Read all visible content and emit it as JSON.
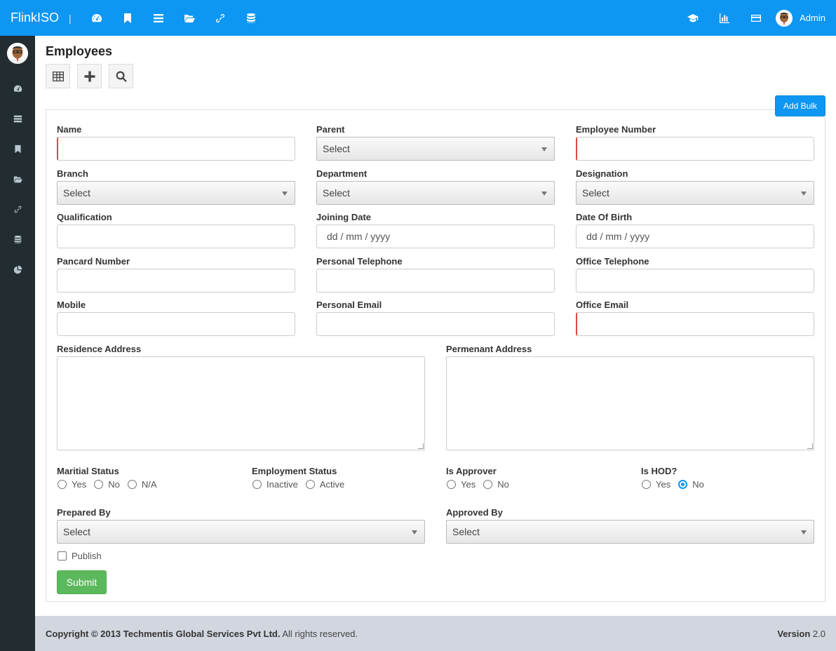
{
  "app": {
    "brand": "FlinkISO",
    "separator": "|",
    "user": "Admin"
  },
  "top_nav": {
    "icons": [
      "dashboard-icon",
      "bookmark-icon",
      "list-icon",
      "folder-open-icon",
      "link-icon",
      "database-icon"
    ]
  },
  "top_right": {
    "icons": [
      "graduation-cap-icon",
      "bar-chart-icon",
      "credit-card-icon"
    ]
  },
  "sidebar": {
    "icons": [
      "dashboard-icon",
      "server-icon",
      "bookmark-icon",
      "folder-open-icon",
      "link-icon",
      "database-icon",
      "pie-chart-icon"
    ]
  },
  "page": {
    "title": "Employees",
    "add_bulk": "Add Bulk",
    "toolbar": [
      "table-icon",
      "plus-icon",
      "search-icon"
    ]
  },
  "form": {
    "name": "Name",
    "parent": "Parent",
    "employee_number": "Employee Number",
    "branch": "Branch",
    "department": "Department",
    "designation": "Designation",
    "qualification": "Qualification",
    "joining_date": "Joining Date",
    "date_of_birth": "Date Of Birth",
    "pancard_number": "Pancard Number",
    "personal_telephone": "Personal Telephone",
    "office_telephone": "Office Telephone",
    "mobile": "Mobile",
    "personal_email": "Personal Email",
    "office_email": "Office Email",
    "residence_address": "Residence Address",
    "permanent_address": "Permenant Address",
    "marital_status": "Maritial Status",
    "employment_status": "Employment Status",
    "is_approver": "Is Approver",
    "is_hod": "Is HOD?",
    "prepared_by": "Prepared By",
    "approved_by": "Approved By",
    "publish": "Publish",
    "submit": "Submit",
    "select_placeholder": "Select",
    "date_placeholder": "dd / mm / yyyy",
    "opt_yes": "Yes",
    "opt_no": "No",
    "opt_na": "N/A",
    "opt_inactive": "Inactive",
    "opt_active": "Active",
    "is_hod_value": "No"
  },
  "footer": {
    "copyright_prefix": "Copyright © 2013",
    "company": "Techmentis Global Services Pvt Ltd.",
    "rights": "All rights reserved.",
    "version_label": "Version",
    "version": "2.0"
  }
}
